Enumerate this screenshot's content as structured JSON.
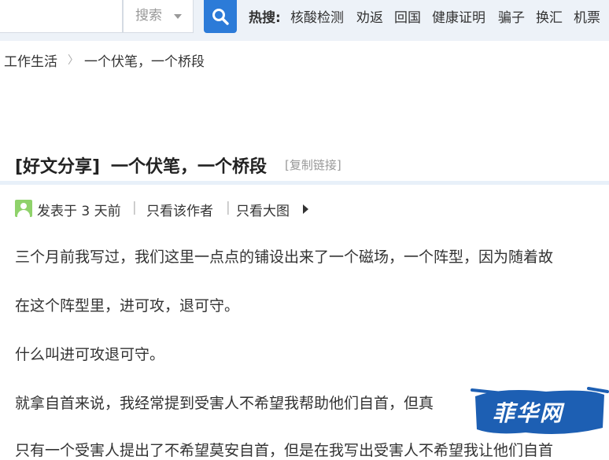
{
  "search": {
    "select_label": "搜索",
    "hot_label": "热搜:",
    "hot_items": [
      "核酸检测",
      "劝返",
      "回国",
      "健康证明",
      "骗子",
      "换汇",
      "机票"
    ]
  },
  "breadcrumb": {
    "section": "工作生活",
    "current": "一个伏笔，一个桥段"
  },
  "post": {
    "tag": "[好文分享]",
    "title": "一个伏笔，一个桥段",
    "copy_link": "[复制链接]",
    "posted": "发表于 3 天前",
    "only_author": "只看该作者",
    "only_images": "只看大图"
  },
  "paragraphs": [
    "三个月前我写过，我们这里一点点的铺设出来了一个磁场，一个阵型，因为随着故",
    "在这个阵型里，进可攻，退可守。",
    "什么叫进可攻退可守。",
    "就拿自首来说，我经常提到受害人不希望我帮助他们自首，但真",
    "只有一个受害人提出了不希望莫安自首，但是在我写出受害人不希望我让他们自首"
  ],
  "watermark": {
    "text": "菲华网"
  },
  "colors": {
    "accent": "#2c7bd8",
    "topbar": "#edf2f8"
  }
}
